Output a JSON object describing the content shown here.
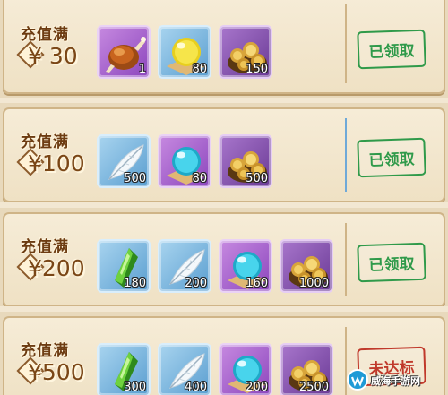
{
  "tiers": [
    {
      "label": "充值满",
      "price": "¥ 30",
      "status": "已领取",
      "status_type": "claimed",
      "items": [
        {
          "icon": "roast-chicken-icon",
          "frame": "purple",
          "qty": "1"
        },
        {
          "icon": "yellow-orb-icon",
          "frame": "blue",
          "qty": "80"
        },
        {
          "icon": "gold-coins-icon",
          "frame": "gold",
          "qty": "150"
        }
      ]
    },
    {
      "label": "充值满",
      "price": "¥100",
      "status": "已领取",
      "status_type": "claimed",
      "items": [
        {
          "icon": "feather-icon",
          "frame": "blue",
          "qty": "500"
        },
        {
          "icon": "blue-orb-icon",
          "frame": "purple",
          "qty": "80"
        },
        {
          "icon": "gold-coins-icon",
          "frame": "gold",
          "qty": "500"
        }
      ]
    },
    {
      "label": "充值满",
      "price": "¥200",
      "status": "已领取",
      "status_type": "claimed",
      "items": [
        {
          "icon": "green-crystal-icon",
          "frame": "blue",
          "qty": "180"
        },
        {
          "icon": "feather-icon",
          "frame": "blue",
          "qty": "200"
        },
        {
          "icon": "blue-orb-icon",
          "frame": "purple",
          "qty": "160"
        },
        {
          "icon": "gold-coins-icon",
          "frame": "gold",
          "qty": "1000"
        }
      ]
    },
    {
      "label": "充值满",
      "price": "¥500",
      "status": "未达标",
      "status_type": "not-reached",
      "items": [
        {
          "icon": "green-crystal-icon",
          "frame": "blue",
          "qty": "300"
        },
        {
          "icon": "feather-icon",
          "frame": "blue",
          "qty": "400"
        },
        {
          "icon": "blue-orb-icon",
          "frame": "purple",
          "qty": "200"
        },
        {
          "icon": "gold-coins-icon",
          "frame": "gold",
          "qty": "2500"
        }
      ]
    }
  ],
  "watermark": {
    "text": "威海手游网",
    "icon": "site-logo-icon"
  },
  "colors": {
    "claimed": "#2f9a4a",
    "not_reached": "#c0392b",
    "panel": "#f6ecd7",
    "border": "#cfb487"
  }
}
